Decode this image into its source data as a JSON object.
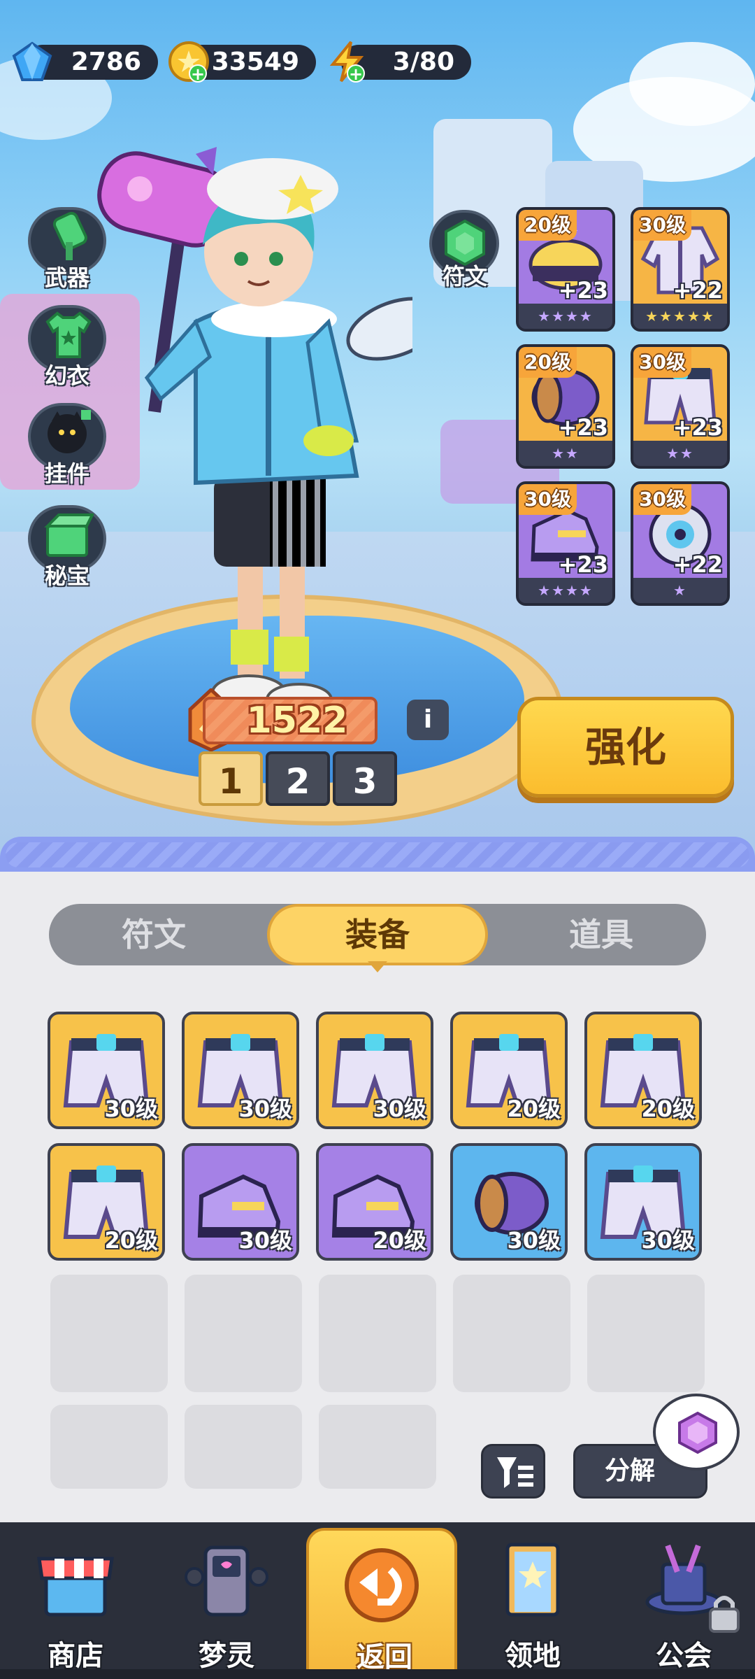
{
  "resources": {
    "gems": "2786",
    "coins": "33549",
    "energy": "3/80"
  },
  "side_menu": {
    "weapon": "武器",
    "costume": "幻衣",
    "pendant": "挂件",
    "treasure": "秘宝",
    "rune": "符文"
  },
  "equipped": [
    {
      "level": "20级",
      "bonus": "+23",
      "stars": "★★★★",
      "color": "#a37be3"
    },
    {
      "level": "30级",
      "bonus": "+22",
      "stars": "★★★★★",
      "color": "#a37be3"
    },
    {
      "level": "20级",
      "bonus": "+23",
      "stars": "★★",
      "color": "#f6b545"
    },
    {
      "level": "30级",
      "bonus": "+23",
      "stars": "★★",
      "color": "#f6b545"
    },
    {
      "level": "30级",
      "bonus": "+23",
      "stars": "★★★★",
      "color": "#a37be3"
    },
    {
      "level": "30级",
      "bonus": "+22",
      "stars": "★",
      "color": "#a37be3"
    }
  ],
  "power": "1522",
  "presets": [
    "1",
    "2",
    "3"
  ],
  "enhance_label": "强化",
  "tabs": [
    "符文",
    "装备",
    "道具"
  ],
  "active_tab": "装备",
  "inventory": [
    {
      "level": "30级",
      "rarity": "gold",
      "item": "shorts-icon"
    },
    {
      "level": "30级",
      "rarity": "gold",
      "item": "shorts-icon"
    },
    {
      "level": "30级",
      "rarity": "gold",
      "item": "shorts-icon"
    },
    {
      "level": "20级",
      "rarity": "gold",
      "item": "shorts-icon"
    },
    {
      "level": "20级",
      "rarity": "gold",
      "item": "shorts-icon"
    },
    {
      "level": "20级",
      "rarity": "gold",
      "item": "shorts-icon"
    },
    {
      "level": "30级",
      "rarity": "purple",
      "item": "shoe-icon"
    },
    {
      "level": "20级",
      "rarity": "purple",
      "item": "shoe-icon"
    },
    {
      "level": "30级",
      "rarity": "blue",
      "item": "wristband-icon"
    },
    {
      "level": "30级",
      "rarity": "blue",
      "item": "shorts-icon"
    }
  ],
  "decompose_label": "分解",
  "nav": {
    "shop": "商店",
    "sprite": "梦灵",
    "back": "返回",
    "territory": "领地",
    "guild": "公会"
  },
  "colors": {
    "gold": "#f7c24a",
    "purple": "#a581e6",
    "blue": "#5db6ee",
    "accent": "#fbbd2e"
  }
}
